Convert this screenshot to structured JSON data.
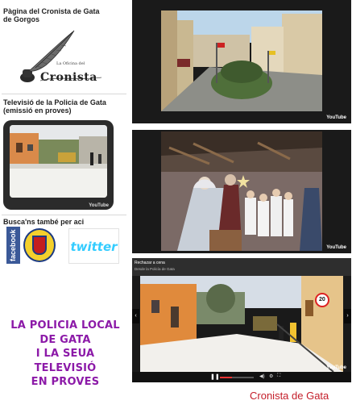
{
  "sidebar": {
    "section1_title": "Pàgina del Cronista de Gata de Gorgos",
    "logo_small_text": "La Oficina del",
    "logo_main_text": "Cronista",
    "section2_title": "Televisió de la Policia de Gata (emissió en proves)",
    "tv_brand": "YouTube",
    "section3_title": "Busca'ns també per aci",
    "facebook_label": "facebook",
    "twitter_label": "twitter"
  },
  "promo_lines": [
    "LA POLICIA LOCAL",
    "DE GATA",
    "I LA SEUA",
    "TELEVISIÓ",
    "EN PROVES"
  ],
  "videos": [
    {
      "brand": "YouTube"
    },
    {
      "brand": "YouTube"
    },
    {
      "brand": "YouTube",
      "title": "Rechazar a cena",
      "subtitle": "Desde la Policía de Gata",
      "progress": 0.35,
      "speed_sign": "20"
    }
  ],
  "signature": "Cronista de Gata",
  "colors": {
    "promo": "#8c1aa8",
    "signature": "#c41e2a",
    "facebook": "#3b5998",
    "twitter": "#33ccff"
  }
}
